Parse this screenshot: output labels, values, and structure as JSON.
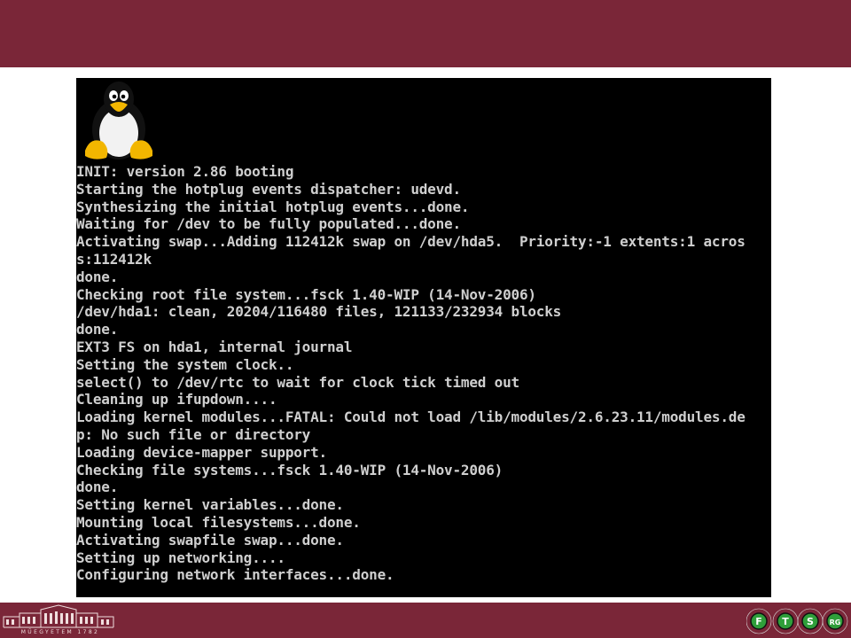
{
  "terminal": {
    "lines": [
      "INIT: version 2.86 booting",
      "Starting the hotplug events dispatcher: udevd.",
      "Synthesizing the initial hotplug events...done.",
      "Waiting for /dev to be fully populated...done.",
      "Activating swap...Adding 112412k swap on /dev/hda5.  Priority:-1 extents:1 acros",
      "s:112412k",
      "done.",
      "Checking root file system...fsck 1.40-WIP (14-Nov-2006)",
      "/dev/hda1: clean, 20204/116480 files, 121133/232934 blocks",
      "done.",
      "EXT3 FS on hda1, internal journal",
      "Setting the system clock..",
      "select() to /dev/rtc to wait for clock tick timed out",
      "Cleaning up ifupdown....",
      "Loading kernel modules...FATAL: Could not load /lib/modules/2.6.23.11/modules.de",
      "p: No such file or directory",
      "Loading device-mapper support.",
      "Checking file systems...fsck 1.40-WIP (14-Nov-2006)",
      "done.",
      "Setting kernel variables...done.",
      "Mounting local filesystems...done.",
      "Activating swapfile swap...done.",
      "Setting up networking....",
      "Configuring network interfaces...done."
    ]
  },
  "footer": {
    "left_logo_text": "MŰEGYETEM 1782",
    "right_logo_letters": [
      "F",
      "T",
      "S",
      "RG"
    ]
  },
  "colors": {
    "band": "#7a2638",
    "terminal_bg": "#000000",
    "terminal_fg": "#cfcfcf"
  }
}
